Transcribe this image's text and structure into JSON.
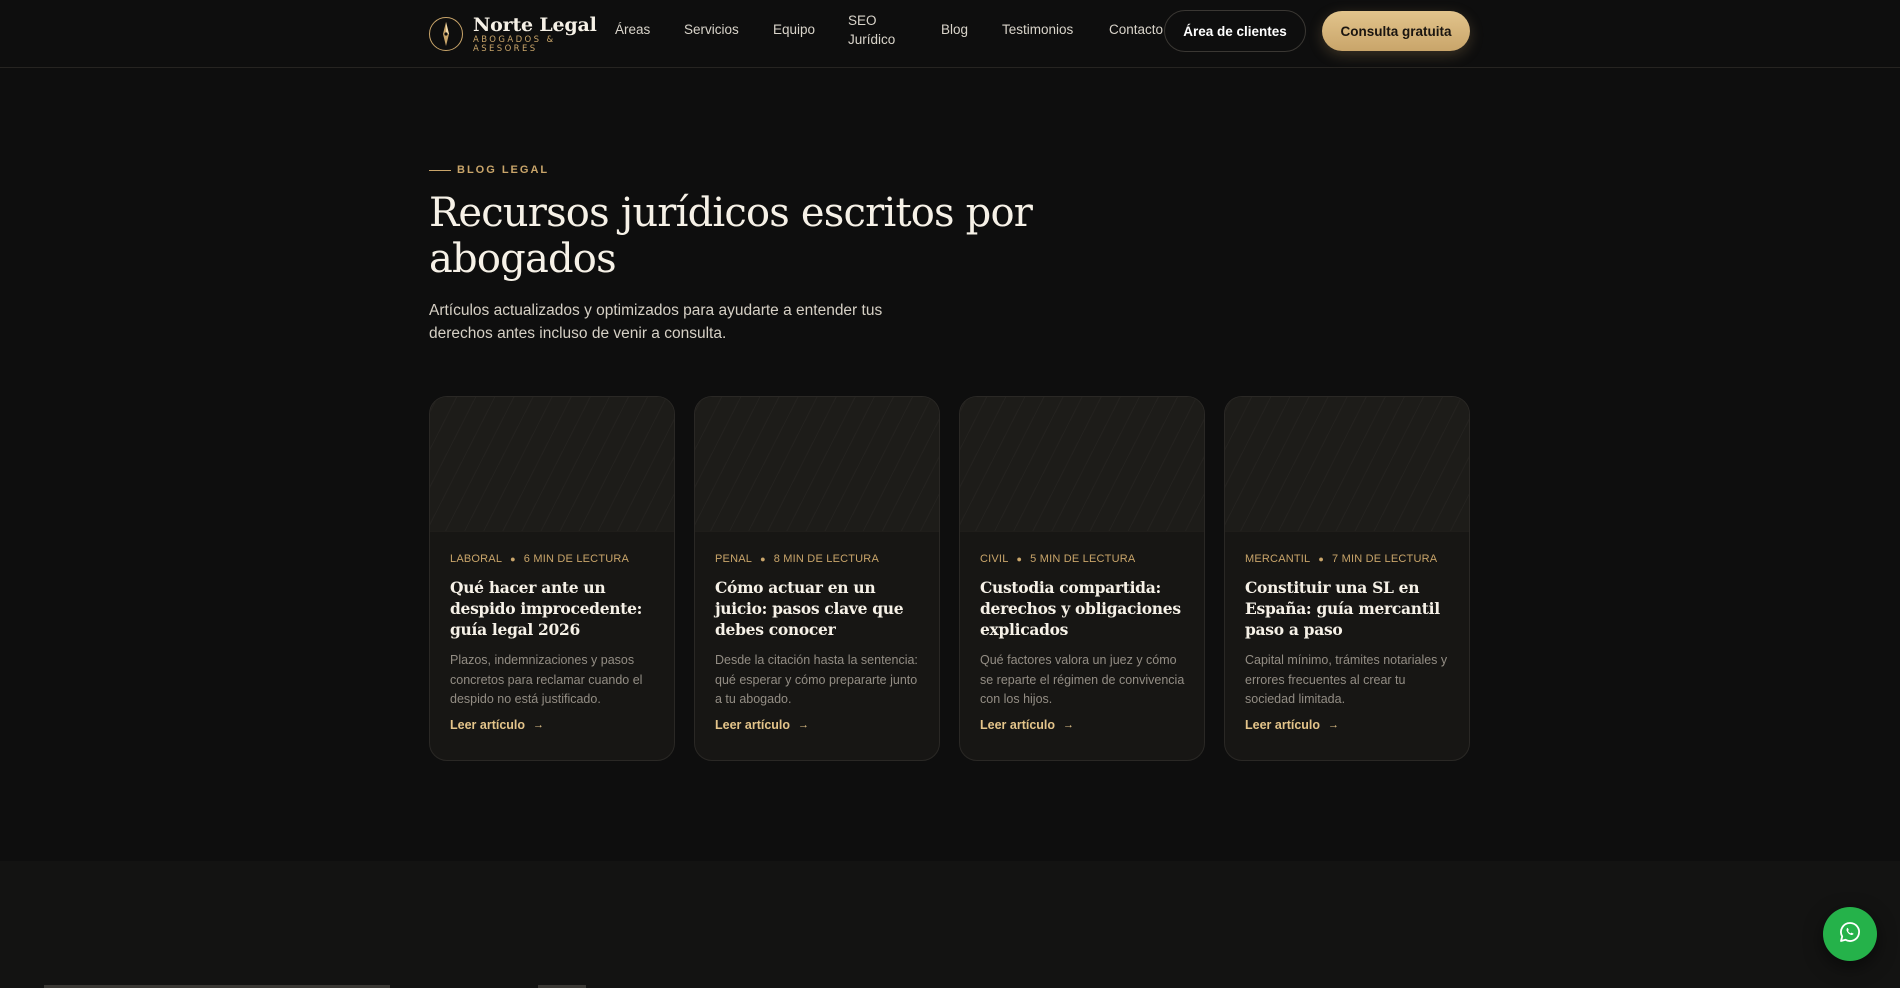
{
  "brand": {
    "name": "Norte Legal",
    "subtitle": "Abogados & Asesores"
  },
  "nav": {
    "links": [
      "Áreas",
      "Servicios",
      "Equipo",
      "SEO Jurídico",
      "Blog",
      "Testimonios",
      "Contacto"
    ],
    "client_area": "Área de clientes",
    "cta": "Consulta gratuita"
  },
  "hero": {
    "eyebrow": "BLOG LEGAL",
    "title": "Recursos jurídicos escritos por abogados",
    "description": "Artículos actualizados y optimizados para ayudarte a entender tus derechos antes incluso de venir a consulta."
  },
  "cards": [
    {
      "category": "Laboral",
      "read_time": "6 min de lectura",
      "title": "Qué hacer ante un despido improcedente: guía legal 2026",
      "excerpt": "Plazos, indemnizaciones y pasos concretos para reclamar cuando el despido no está justificado.",
      "link": "Leer artículo"
    },
    {
      "category": "Penal",
      "read_time": "8 min de lectura",
      "title": "Cómo actuar en un juicio: pasos clave que debes conocer",
      "excerpt": "Desde la citación hasta la sentencia: qué esperar y cómo prepararte junto a tu abogado.",
      "link": "Leer artículo"
    },
    {
      "category": "Civil",
      "read_time": "5 min de lectura",
      "title": "Custodia compartida: derechos y obligaciones explicados",
      "excerpt": "Qué factores valora un juez y cómo se reparte el régimen de convivencia con los hijos.",
      "link": "Leer artículo"
    },
    {
      "category": "Mercantil",
      "read_time": "7 min de lectura",
      "title": "Constituir una SL en España: guía mercantil paso a paso",
      "excerpt": "Capital mínimo, trámites notariales y errores frecuentes al crear tu sociedad limitada.",
      "link": "Leer artículo"
    }
  ],
  "icons": {
    "brand": "compass-icon",
    "arrow": "arrow-right-icon",
    "whatsapp": "whatsapp-icon"
  },
  "colors": {
    "background": "#0e0e0e",
    "accent_gold": "#c9a56a",
    "whatsapp_green": "#25b24a"
  }
}
